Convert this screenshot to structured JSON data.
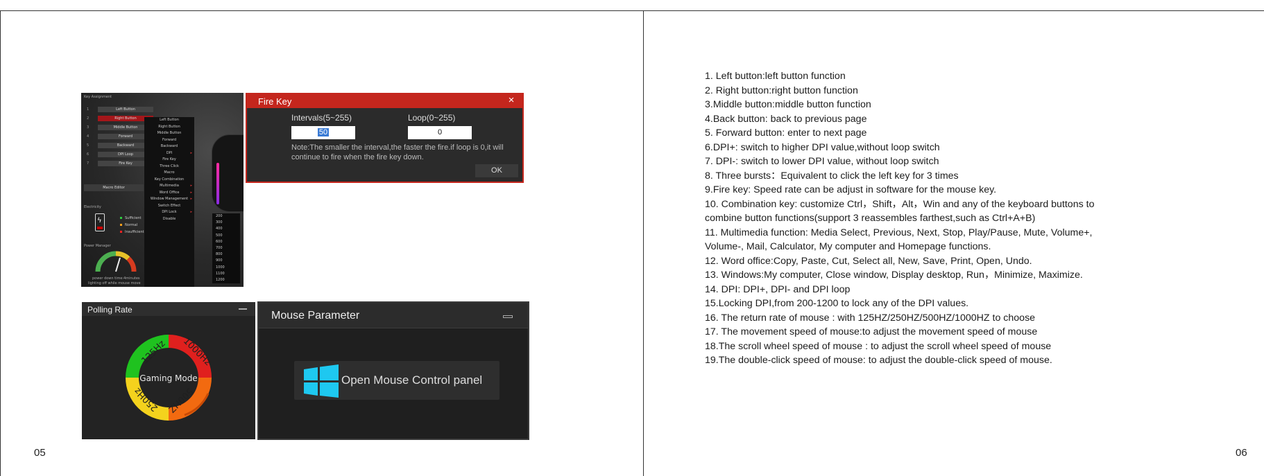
{
  "page_numbers": {
    "left": "05",
    "right": "06"
  },
  "key_assignment": {
    "title": "Key Assignment",
    "buttons": [
      {
        "n": "1",
        "label": "Left Button"
      },
      {
        "n": "2",
        "label": "Right Button"
      },
      {
        "n": "3",
        "label": "Middle Button"
      },
      {
        "n": "4",
        "label": "Forward"
      },
      {
        "n": "5",
        "label": "Backward"
      },
      {
        "n": "6",
        "label": "DPI Loop"
      },
      {
        "n": "7",
        "label": "Fire Key"
      }
    ],
    "menu": [
      "Left Button",
      "Right Button",
      "Middle Button",
      "Forward",
      "Backward",
      "DPI",
      "Fire Key",
      "Three Click",
      "Macro",
      "Key Combination",
      "Multimedia",
      "Word Office",
      "Window Management",
      "Switch Effect",
      "DPI Lock",
      "Disable"
    ],
    "macro_editor": "Macro Editor",
    "dpi_values": [
      "200",
      "300",
      "400",
      "500",
      "600",
      "700",
      "800",
      "900",
      "1000",
      "1100",
      "1200"
    ],
    "electricity_title": "Electricity",
    "battery_legend": [
      {
        "label": "Sufficient",
        "color": "#2ecc40"
      },
      {
        "label": "Normal",
        "color": "#ff9f1a"
      },
      {
        "label": "Insufficient",
        "color": "#ff2222"
      }
    ],
    "power_manager_title": "Power Manager",
    "power_down_label": "power down time:4minutes",
    "lighting_off_label": "lighting off while mouse move"
  },
  "fire_key": {
    "title": "Fire Key",
    "close_icon": "×",
    "intervals_label": "Intervals(5~255)",
    "intervals_value": "50",
    "loop_label": "Loop(0~255)",
    "loop_value": "0",
    "note": "Note:The smaller the interval,the faster the fire.if loop is 0,it will continue to fire when the fire key down.",
    "ok_label": "OK"
  },
  "polling_rate": {
    "title": "Polling Rate",
    "center_label": "Gaming Mode",
    "segments": [
      {
        "label": "125Hz",
        "color": "#1fc21f"
      },
      {
        "label": "1000Hz",
        "color": "#e0201e"
      },
      {
        "label": "500HZ",
        "color": "#f26a10"
      },
      {
        "label": "250Hz",
        "color": "#f4d21d"
      }
    ]
  },
  "mouse_parameter": {
    "title": "Mouse Parameter",
    "open_button_label": "Open Mouse Control panel",
    "windows_color": "#1ec8f0"
  },
  "functions": [
    "1. Left button:left button function",
    "2. Right button:right button function",
    "3.Middle button:middle button function",
    "4.Back button: back to previous page",
    "5. Forward button: enter to next page",
    "6.DPI+: switch to higher DPI value,without loop switch",
    "7. DPI-: switch to lower DPI value, without loop switch",
    "8. Three bursts：Equivalent to click the left key for 3 times",
    "9.Fire key: Speed rate can be adjust in software for the mouse key.",
    "10. Combination key: customize Ctrl，Shift，Alt，Win and any of the keyboard buttons to",
    "combine button functions(support 3 reassembles farthest,such as Ctrl+A+B)",
    "11. Multimedia function: Media Select, Previous, Next, Stop, Play/Pause, Mute, Volume+,",
    "Volume-, Mail, Calculator, My computer and Homepage functions.",
    "12. Word office:Copy, Paste, Cut, Select all, New, Save, Print, Open, Undo.",
    "13. Windows:My computer, Close window, Display desktop, Run，Minimize, Maximize.",
    "14. DPI: DPI+, DPI- and DPI loop",
    "15.Locking DPI,from 200-1200 to lock any of the DPI values.",
    "16. The return rate of mouse : with 125HZ/250HZ/500HZ/1000HZ to choose",
    "17. The movement speed of mouse:to adjust the movement speed of mouse",
    "18.The scroll wheel speed of mouse : to adjust the scroll wheel speed of mouse",
    "19.The double-click speed of mouse: to adjust the double-click speed of mouse."
  ]
}
